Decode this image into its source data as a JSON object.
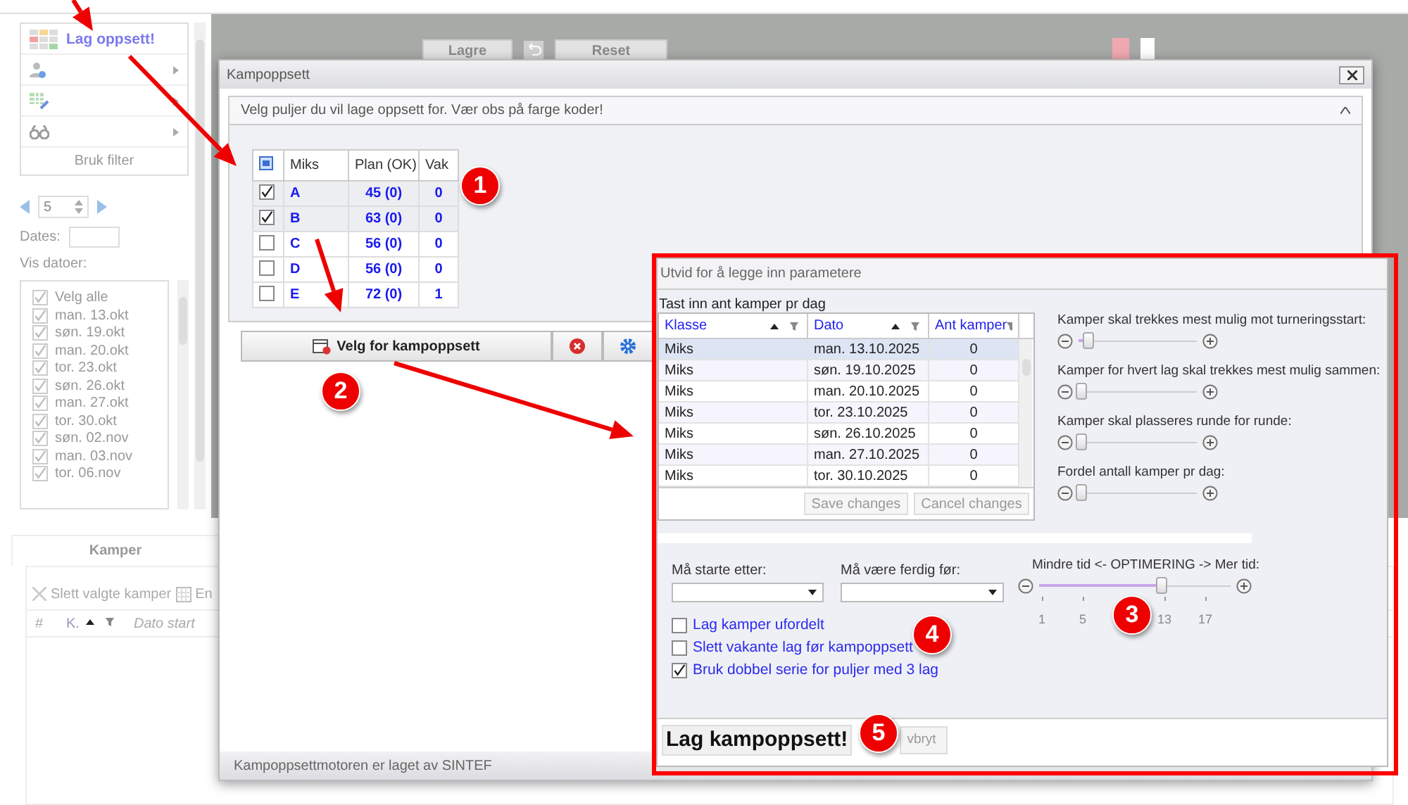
{
  "sidebar": {
    "menu_items": [
      {
        "kind": "grid",
        "label": "Lag oppsett!"
      },
      {
        "kind": "user"
      },
      {
        "kind": "edit"
      },
      {
        "kind": "binoculars"
      }
    ],
    "filter_button": "Bruk filter",
    "spinner": "5",
    "dates_label": "Dates:",
    "show_dates_label": "Vis datoer:",
    "dates": [
      {
        "label": "Velg alle",
        "checked": true
      },
      {
        "label": "man. 13.okt",
        "checked": true
      },
      {
        "label": "søn. 19.okt",
        "checked": true
      },
      {
        "label": "man. 20.okt",
        "checked": true
      },
      {
        "label": "tor. 23.okt",
        "checked": true
      },
      {
        "label": "søn. 26.okt",
        "checked": true
      },
      {
        "label": "man. 27.okt",
        "checked": true
      },
      {
        "label": "tor. 30.okt",
        "checked": true
      },
      {
        "label": "søn. 02.nov",
        "checked": true
      },
      {
        "label": "man. 03.nov",
        "checked": true
      },
      {
        "label": "tor. 06.nov",
        "checked": true
      }
    ]
  },
  "toolbar": {
    "save": "Lagre",
    "reset": "Reset"
  },
  "bottom_panel": {
    "tab": "Kamper",
    "delete_button": "Slett valgte kamper",
    "second_button": "En",
    "columns": [
      "#",
      "K.",
      "Dato start"
    ]
  },
  "dialog": {
    "title": "Kampoppsett",
    "section_title": "Velg puljer du vil lage oppsett for. Vær obs på farge koder!",
    "columns": [
      "Miks",
      "Plan (OK)",
      "Vak"
    ],
    "rows": [
      {
        "name": "A",
        "plan": "45 (0)",
        "vak": "0",
        "checked": true
      },
      {
        "name": "B",
        "plan": "63 (0)",
        "vak": "0",
        "checked": true
      },
      {
        "name": "C",
        "plan": "56 (0)",
        "vak": "0",
        "checked": false
      },
      {
        "name": "D",
        "plan": "56 (0)",
        "vak": "0",
        "checked": false
      },
      {
        "name": "E",
        "plan": "72 (0)",
        "vak": "1",
        "checked": false
      }
    ],
    "select_button": "Velg for kampoppsett",
    "footer": "Kampoppsettmotoren er laget av SINTEF"
  },
  "params": {
    "title": "Utvid for å legge inn parametere",
    "table_caption": "Tast inn ant kamper pr dag",
    "columns": [
      {
        "label": "Klasse",
        "sortable": true
      },
      {
        "label": "Dato",
        "sortable": true
      },
      {
        "label": "Ant kamper",
        "sortable": false
      }
    ],
    "rows": [
      {
        "klasse": "Miks",
        "dato": "man. 13.10.2025",
        "antall": "0",
        "selected": true
      },
      {
        "klasse": "Miks",
        "dato": "søn. 19.10.2025",
        "antall": "0",
        "selected": false
      },
      {
        "klasse": "Miks",
        "dato": "man. 20.10.2025",
        "antall": "0",
        "selected": false
      },
      {
        "klasse": "Miks",
        "dato": "tor. 23.10.2025",
        "antall": "0",
        "selected": false
      },
      {
        "klasse": "Miks",
        "dato": "søn. 26.10.2025",
        "antall": "0",
        "selected": false
      },
      {
        "klasse": "Miks",
        "dato": "man. 27.10.2025",
        "antall": "0",
        "selected": false
      },
      {
        "klasse": "Miks",
        "dato": "tor. 30.10.2025",
        "antall": "0",
        "selected": false
      }
    ],
    "save_button": "Save changes",
    "cancel_changes_button": "Cancel changes",
    "sliders": [
      {
        "label": "Kamper skal trekkes mest mulig mot turneringsstart:",
        "level": 0.08
      },
      {
        "label": "Kamper for hvert lag skal trekkes mest mulig sammen:",
        "level": 0.02
      },
      {
        "label": "Kamper skal plasseres runde for runde:",
        "level": 0.02
      },
      {
        "label": "Fordel antall kamper pr dag:",
        "level": 0.02
      }
    ],
    "start_label": "Må starte etter:",
    "end_label": "Må være ferdig før:",
    "optimization": {
      "label": "Mindre tid <- OPTIMERING -> Mer tid:",
      "level": 0.64,
      "ticks": [
        "1",
        "5",
        "13",
        "17"
      ]
    },
    "options": [
      {
        "label": "Lag kamper ufordelt",
        "checked": false
      },
      {
        "label": "Slett vakante lag før kampoppsett",
        "checked": false
      },
      {
        "label": "Bruk dobbel serie for puljer med 3 lag",
        "checked": true
      }
    ],
    "run_button": "Lag kampoppsett!",
    "abort_button": "vbryt"
  },
  "steps": [
    "1",
    "2",
    "3",
    "4",
    "5"
  ]
}
